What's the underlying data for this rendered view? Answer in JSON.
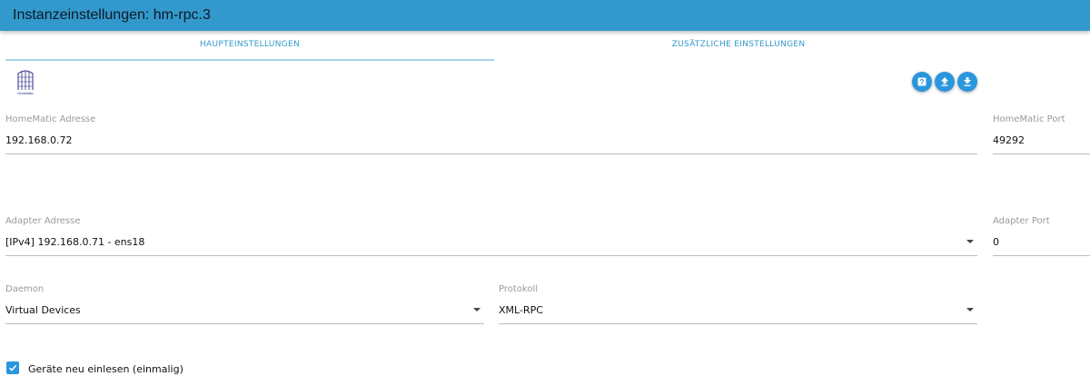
{
  "window": {
    "title": "Instanzeinstellungen: hm-rpc.3"
  },
  "tabs": [
    {
      "label": "HAUPTEINSTELLUNGEN",
      "active": true
    },
    {
      "label": "ZUSÄTZLICHE EINSTELLUNGEN",
      "active": false
    }
  ],
  "logo": {
    "text": "HomeMatic"
  },
  "toolbar": {
    "icons": [
      "help-icon",
      "upload-icon",
      "download-icon"
    ]
  },
  "fields": {
    "homematic_address": {
      "label": "HomeMatic Adresse",
      "value": "192.168.0.72"
    },
    "homematic_port": {
      "label": "HomeMatic Port",
      "value": "49292"
    },
    "adapter_address": {
      "label": "Adapter Adresse",
      "value": "[IPv4] 192.168.0.71 - ens18"
    },
    "adapter_port": {
      "label": "Adapter Port",
      "value": "0"
    },
    "daemon": {
      "label": "Daemon",
      "value": "Virtual Devices"
    },
    "protocol": {
      "label": "Protokoll",
      "value": "XML-RPC"
    }
  },
  "checkbox": {
    "label": "Geräte neu einlesen (einmalig)",
    "checked": true
  },
  "colors": {
    "accent": "#3399cc",
    "button": "#2a96de"
  }
}
